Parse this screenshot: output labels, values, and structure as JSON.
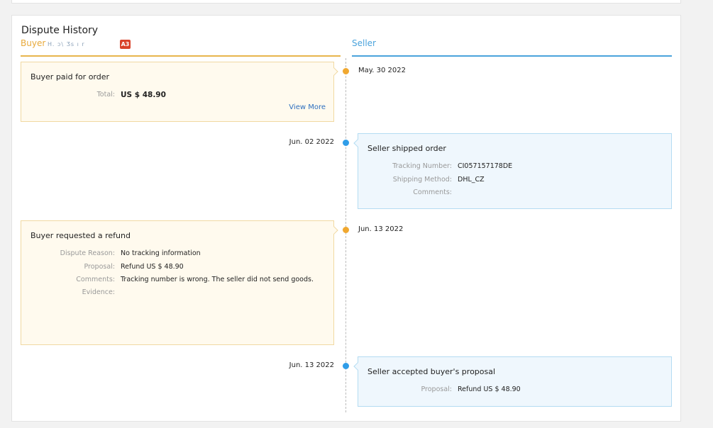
{
  "title": "Dispute History",
  "columns": {
    "buyer_label": "Buyer",
    "buyer_name": "H.  ɔ\\   Ʒs  ı  r",
    "buyer_badge": "A3",
    "seller_label": "Seller"
  },
  "colors": {
    "buyer_accent": "#e8b54d",
    "seller_accent": "#4aa3dc",
    "buyer_dot": "#f0a830",
    "seller_dot": "#2f9de8",
    "badge": "#d9432a"
  },
  "events": [
    {
      "side": "buyer",
      "date": "May. 30 2022",
      "title": "Buyer paid for order",
      "fields": [
        {
          "label": "Total:",
          "value": "US $ 48.90"
        }
      ],
      "link": "View More"
    },
    {
      "side": "seller",
      "date": "Jun. 02 2022",
      "title": "Seller shipped order",
      "fields": [
        {
          "label": "Tracking Number:",
          "value": "CI057157178DE"
        },
        {
          "label": "Shipping Method:",
          "value": "DHL_CZ"
        },
        {
          "label": "Comments:",
          "value": ""
        }
      ]
    },
    {
      "side": "buyer",
      "date": "Jun. 13 2022",
      "title": "Buyer requested a refund",
      "fields": [
        {
          "label": "Dispute Reason:",
          "value": "No tracking information"
        },
        {
          "label": "Proposal:",
          "value": "Refund US $ 48.90"
        },
        {
          "label": "Comments:",
          "value": "Tracking number is wrong. The seller did not send goods."
        },
        {
          "label": "Evidence:",
          "value": ""
        }
      ]
    },
    {
      "side": "seller",
      "date": "Jun. 13 2022",
      "title": "Seller accepted buyer's proposal",
      "fields": [
        {
          "label": "Proposal:",
          "value": "Refund US $ 48.90"
        }
      ]
    }
  ]
}
